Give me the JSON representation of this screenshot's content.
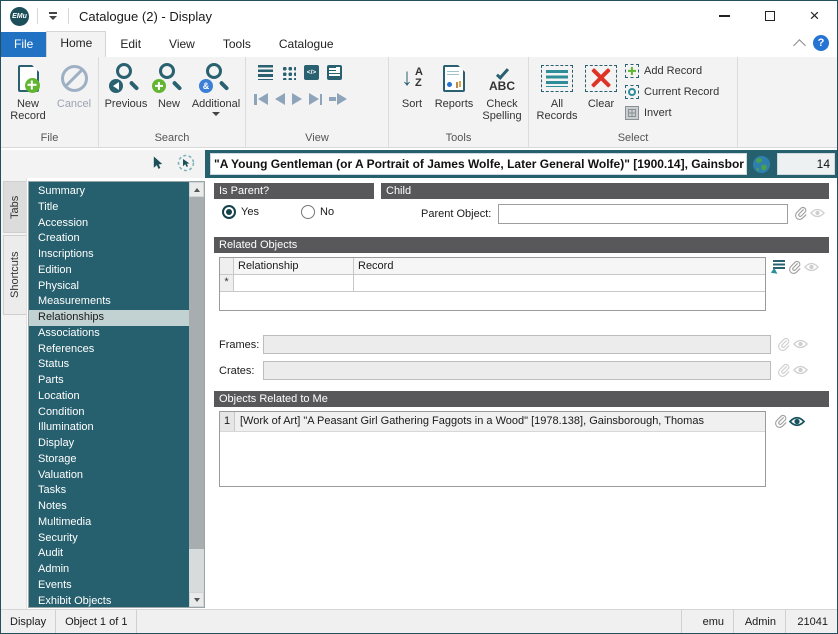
{
  "window": {
    "logo_text": "EMu",
    "title": "Catalogue (2) - Display"
  },
  "ribbon": {
    "tabs": [
      "File",
      "Home",
      "Edit",
      "View",
      "Tools",
      "Catalogue"
    ],
    "active_tab": "Home",
    "file_group": {
      "label": "File",
      "new_record": "New Record",
      "cancel": "Cancel"
    },
    "search_group": {
      "label": "Search",
      "previous": "Previous",
      "new": "New",
      "additional": "Additional"
    },
    "view_group": {
      "label": "View"
    },
    "tools_group": {
      "label": "Tools",
      "sort": "Sort",
      "reports": "Reports",
      "check_spelling": "Check Spelling"
    },
    "select_group": {
      "label": "Select",
      "all_records": "All Records",
      "clear": "Clear",
      "add_record": "Add Record",
      "current_record": "Current Record",
      "invert": "Invert"
    }
  },
  "icons": {
    "sort_a": "A",
    "sort_z": "Z",
    "check_abc": "ABC",
    "additional_amp": "&",
    "code_view": "</>"
  },
  "record_bar": {
    "title": "\"A Young Gentleman (or A Portrait of James Wolfe, Later General Wolfe)\" [1900.14], Gainsbor",
    "count": "14"
  },
  "sidebar": {
    "strip": [
      "Tabs",
      "Shortcuts"
    ],
    "selected": "Relationships",
    "items": [
      "Summary",
      "Title",
      "Accession",
      "Creation",
      "Inscriptions",
      "Edition",
      "Physical",
      "Measurements",
      "Relationships",
      "Associations",
      "References",
      "Status",
      "Parts",
      "Location",
      "Condition",
      "Illumination",
      "Display",
      "Storage",
      "Valuation",
      "Tasks",
      "Notes",
      "Multimedia",
      "Security",
      "Audit",
      "Admin",
      "Events",
      "Exhibit Objects"
    ]
  },
  "form": {
    "is_parent": {
      "header": "Is Parent?",
      "yes_label": "Yes",
      "no_label": "No",
      "selected": "Yes"
    },
    "child": {
      "header": "Child",
      "parent_object_label": "Parent Object:",
      "parent_object_value": ""
    },
    "related_objects": {
      "header": "Related Objects",
      "col_relationship": "Relationship",
      "col_record": "Record",
      "new_row_marker": "*"
    },
    "frames_label": "Frames:",
    "crates_label": "Crates:",
    "objects_related_to_me": {
      "header": "Objects Related to Me",
      "rows": [
        {
          "num": "1",
          "text": "[Work of Art]  \"A Peasant Girl Gathering Faggots in a Wood\" [1978.138], Gainsborough, Thomas"
        }
      ]
    }
  },
  "status_bar": {
    "mode": "Display",
    "position": "Object 1 of 1",
    "db": "emu",
    "user": "Admin",
    "record_number": "21041"
  },
  "colors": {
    "teal": "#265f6d",
    "header_gray": "#58585a",
    "file_tab_blue": "#2272c3",
    "green": "#62b531",
    "red": "#dd3226"
  }
}
